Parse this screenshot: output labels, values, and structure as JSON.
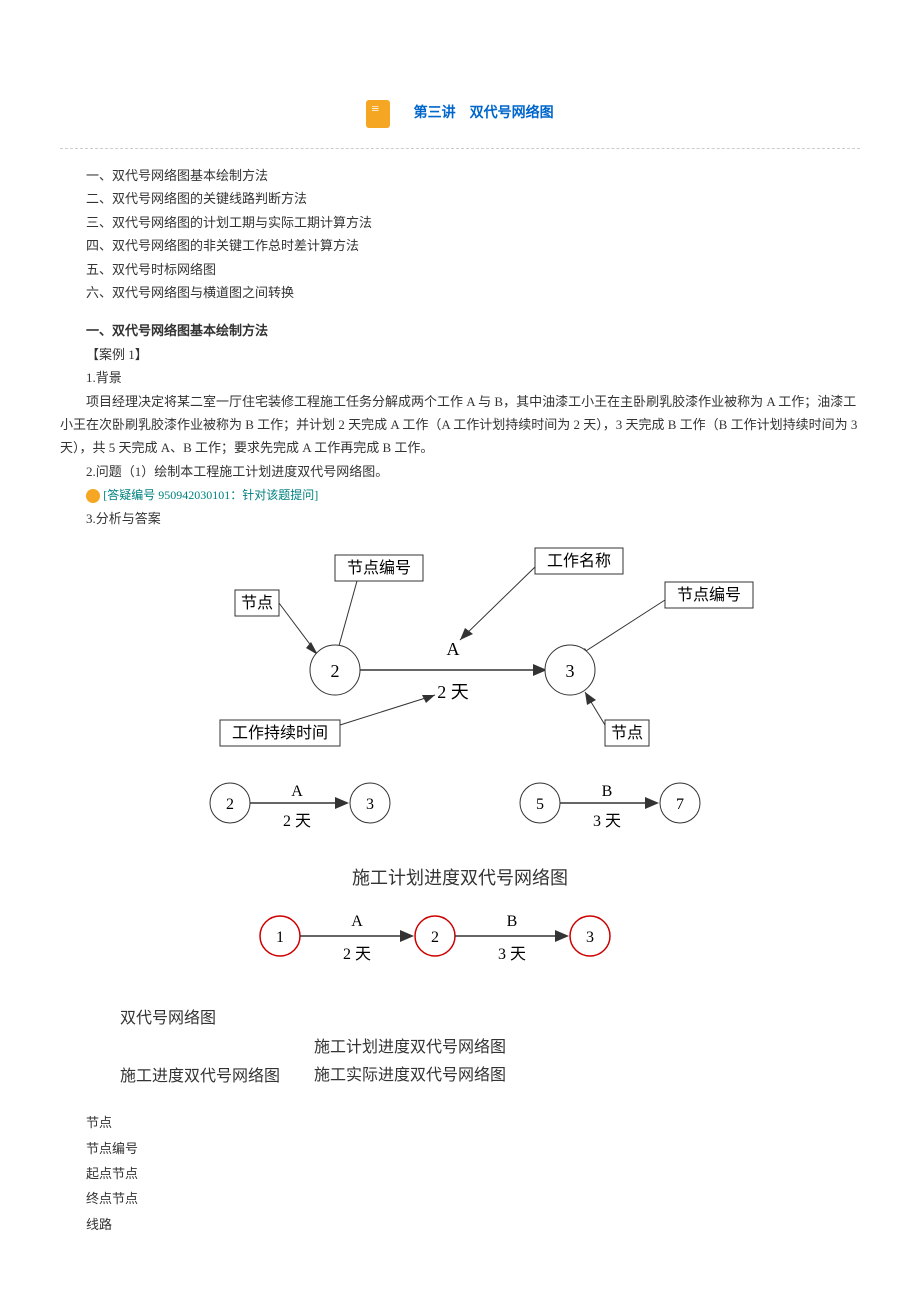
{
  "header": {
    "title": "第三讲　双代号网络图"
  },
  "outline": {
    "i1": "一、双代号网络图基本绘制方法",
    "i2": "二、双代号网络图的关键线路判断方法",
    "i3": "三、双代号网络图的计划工期与实际工期计算方法",
    "i4": "四、双代号网络图的非关键工作总时差计算方法",
    "i5": "五、双代号时标网络图",
    "i6": "六、双代号网络图与横道图之间转换"
  },
  "section1": {
    "title": "一、双代号网络图基本绘制方法",
    "case": "【案例 1】",
    "bg_label": "1.背景",
    "bg_text": "项目经理决定将某二室一厅住宅装修工程施工任务分解成两个工作 A 与 B，其中油漆工小王在主卧刷乳胶漆作业被称为 A 工作；油漆工小王在次卧刷乳胶漆作业被称为 B 工作；并计划 2 天完成 A 工作（A 工作计划持续时间为 2 天），3 天完成 B 工作（B 工作计划持续时间为 3 天），共 5 天完成 A、B 工作；要求先完成 A 工作再完成 B 工作。",
    "q_label": "2.问题（1）绘制本工程施工计划进度双代号网络图。",
    "q_link": "[答疑编号 950942030101：针对该题提问]",
    "ans_label": "3.分析与答案"
  },
  "diagram": {
    "annot": {
      "node": "节点",
      "node_num": "节点编号",
      "work_name": "工作名称",
      "work_dur": "工作持续时间"
    },
    "top": {
      "n1": "2",
      "n2": "3",
      "work": "A",
      "dur": "2 天"
    },
    "mid_left": {
      "n1": "2",
      "n2": "3",
      "work": "A",
      "dur": "2 天"
    },
    "mid_right": {
      "n1": "5",
      "n2": "7",
      "work": "B",
      "dur": "3 天"
    },
    "mid_caption": "施工计划进度双代号网络图",
    "bottom": {
      "n1": "1",
      "n2": "2",
      "n3": "3",
      "w1": "A",
      "d1": "2 天",
      "w2": "B",
      "d2": "3 天"
    },
    "labels": {
      "l1": "双代号网络图",
      "l2a": "施工进度双代号网络图",
      "l2b": "施工计划进度双代号网络图",
      "l2c": "施工实际进度双代号网络图"
    }
  },
  "terms": {
    "t1": "节点",
    "t2": "节点编号",
    "t3": "起点节点",
    "t4": "终点节点",
    "t5": "线路"
  }
}
